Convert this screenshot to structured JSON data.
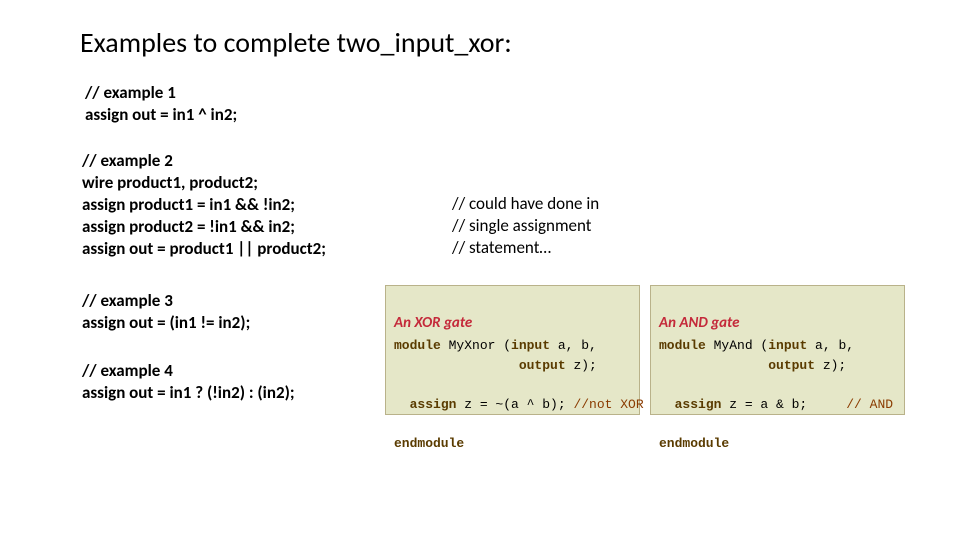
{
  "title": "Examples to complete two_input_xor:",
  "ex1": "// example 1\nassign out = in1 ^ in2;",
  "ex2": "// example 2\nwire product1, product2;\nassign product1 = in1 && !in2;\nassign product2 = !in1 && in2;\nassign out = product1 || product2;",
  "note": "// could have done in\n// single assignment\n// statement…",
  "ex3": "// example 3\nassign out = (in1 != in2);",
  "ex4": "// example 4\nassign out = in1 ? (!in2) : (in2);",
  "xor": {
    "title": "An XOR gate",
    "l1a": "module",
    "l1b": " MyXnor (",
    "l1c": "input",
    "l1d": " a, b,",
    "l2a": "                ",
    "l2b": "output",
    "l2c": " z);",
    "l3a": "  ",
    "l3b": "assign",
    "l3c": " z = ~(a ^ b); ",
    "l3d": "//not XOR",
    "l4": "endmodule"
  },
  "and": {
    "title": "An AND gate",
    "l1a": "module",
    "l1b": " MyAnd (",
    "l1c": "input",
    "l1d": " a, b,",
    "l2a": "              ",
    "l2b": "output",
    "l2c": " z);",
    "l3a": "  ",
    "l3b": "assign",
    "l3c": " z = a & b;     ",
    "l3d": "// AND",
    "l4": "endmodule"
  }
}
